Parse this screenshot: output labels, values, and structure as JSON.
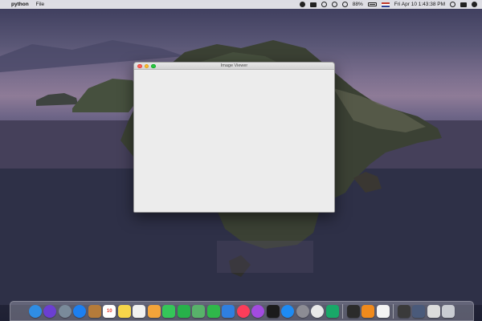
{
  "menubar": {
    "apple_glyph": "",
    "app_name": "python",
    "menus": [
      "File"
    ],
    "battery_text": "88%",
    "clock": "Fri Apr 10  1:43:38 PM"
  },
  "window": {
    "title": "Image Viewer"
  },
  "dock": {
    "calendar_day": "10",
    "apps": [
      {
        "name": "finder-icon",
        "color": "#2f8de4"
      },
      {
        "name": "siri-icon",
        "color": "#6b3fd1"
      },
      {
        "name": "launchpad-icon",
        "color": "#7a8a9a"
      },
      {
        "name": "safari-icon",
        "color": "#1d7ff0"
      },
      {
        "name": "notebook-icon",
        "color": "#b57b3a"
      },
      {
        "name": "calendar-icon",
        "color": "#ffffff"
      },
      {
        "name": "notes-icon",
        "color": "#f7d64a"
      },
      {
        "name": "reminders-icon",
        "color": "#f1f1f1"
      },
      {
        "name": "photos-icon",
        "color": "#f3a43a"
      },
      {
        "name": "messages-icon",
        "color": "#35c659"
      },
      {
        "name": "facetime-icon",
        "color": "#27b14a"
      },
      {
        "name": "maps-icon",
        "color": "#58b26a"
      },
      {
        "name": "numbers-icon",
        "color": "#2fb84a"
      },
      {
        "name": "keynote-icon",
        "color": "#2f7fe0"
      },
      {
        "name": "music-icon",
        "color": "#fb3d5a"
      },
      {
        "name": "podcasts-icon",
        "color": "#a24be0"
      },
      {
        "name": "tv-icon",
        "color": "#1b1b1b"
      },
      {
        "name": "app-store-icon",
        "color": "#1e8bf3"
      },
      {
        "name": "system-preferences-icon",
        "color": "#8c8c94"
      },
      {
        "name": "chrome-icon",
        "color": "#e9e9e9"
      },
      {
        "name": "pycharm-icon",
        "color": "#19a868"
      },
      {
        "name": "terminal-icon",
        "color": "#2b2b2b"
      },
      {
        "name": "vlc-icon",
        "color": "#f08a1c"
      },
      {
        "name": "document-icon",
        "color": "#f4f4f4"
      },
      {
        "name": "minimized-window-1-icon",
        "color": "#3a3a3a"
      },
      {
        "name": "minimized-window-2-icon",
        "color": "#4a5a7a"
      },
      {
        "name": "minimized-window-3-icon",
        "color": "#dcdcdc"
      },
      {
        "name": "trash-icon",
        "color": "#c9ccd2"
      }
    ]
  }
}
